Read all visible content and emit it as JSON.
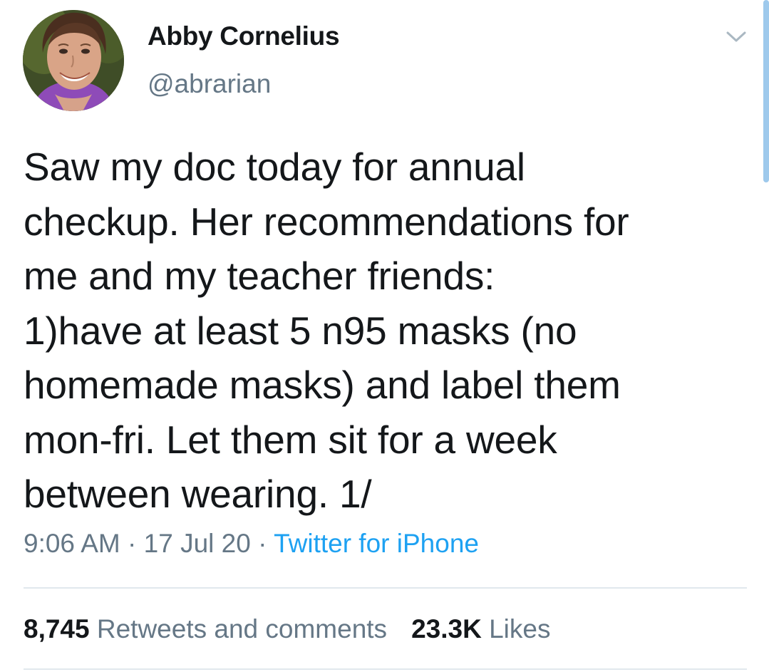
{
  "tweet": {
    "author": {
      "display_name": "Abby Cornelius",
      "handle": "@abrarian",
      "avatar_icon": "profile-photo"
    },
    "text_lines": [
      "Saw my doc today for annual",
      "checkup. Her recommendations for",
      "me and my teacher friends:",
      "1)have at least 5 n95 masks (no",
      "homemade masks) and label them",
      "mon-fri. Let them sit for a week",
      "between wearing. 1/"
    ],
    "time": "9:06 AM",
    "separator": "·",
    "date": "17 Jul 20",
    "source": "Twitter for iPhone",
    "stats": {
      "retweets_count": "8,745",
      "retweets_label": "Retweets and comments",
      "likes_count": "23.3K",
      "likes_label": "Likes"
    }
  },
  "colors": {
    "text": "#14171a",
    "secondary": "#657786",
    "link": "#1da1f2",
    "divider": "#e1e8ed",
    "scroll": "#9ec9ec"
  },
  "icons": {
    "menu": "chevron-down-icon"
  }
}
